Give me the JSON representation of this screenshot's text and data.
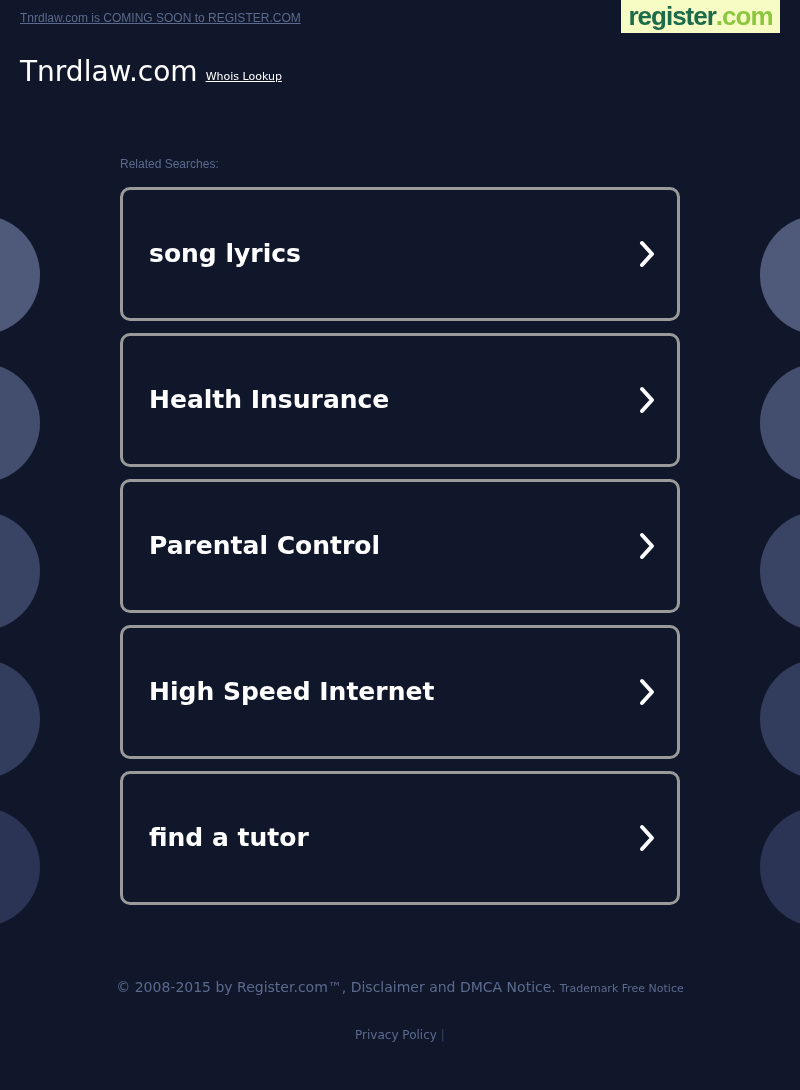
{
  "top_banner": {
    "link": "Tnrdlaw.com is COMING SOON to REGISTER.COM",
    "logo": {
      "name": "register",
      "suffix": ".com"
    }
  },
  "header": {
    "domain": "Tnrdlaw.com",
    "whois_link": "Whois Lookup"
  },
  "related": {
    "heading": "Related Searches:",
    "items": [
      {
        "label": "song lyrics"
      },
      {
        "label": "Health Insurance"
      },
      {
        "label": "Parental Control"
      },
      {
        "label": "High Speed Internet"
      },
      {
        "label": "find a tutor"
      }
    ]
  },
  "footer": {
    "copyright": "© 2008-2015 by Register.com™, Disclaimer and DMCA Notice.",
    "trademark": "Trademark Free Notice",
    "privacy": "Privacy Policy",
    "separator": "|"
  }
}
